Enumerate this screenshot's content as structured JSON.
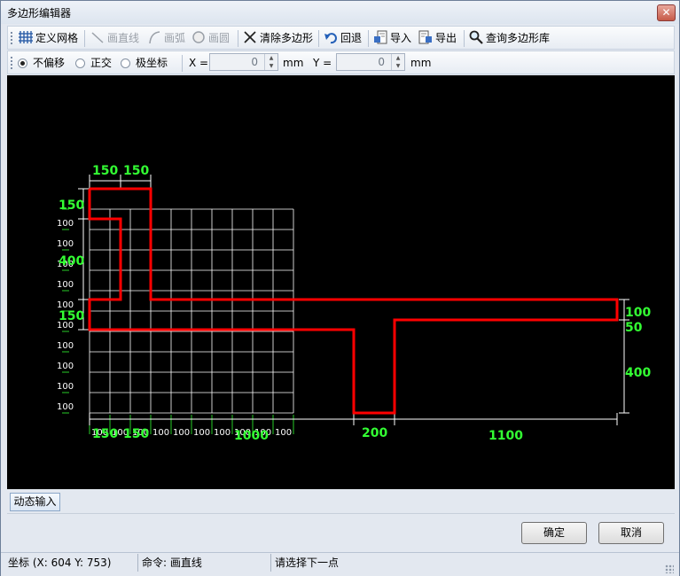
{
  "window": {
    "title": "多边形编辑器",
    "close": "✕"
  },
  "toolbar": {
    "define_grid": "定义网格",
    "draw_line": "画直线",
    "draw_arc": "画弧",
    "draw_circle": "画圆",
    "clear_polygon": "清除多边形",
    "undo": "回退",
    "import": "导入",
    "export": "导出",
    "query_library": "查询多边形库"
  },
  "mode_bar": {
    "no_offset": "不偏移",
    "orthogonal": "正交",
    "polar": "极坐标",
    "selected": "no_offset",
    "x_label": "X =",
    "x_value": "0",
    "x_unit": "mm",
    "y_label": "Y =",
    "y_value": "0",
    "y_unit": "mm"
  },
  "canvas": {
    "colors": {
      "background": "#000000",
      "grid": "#ffffff",
      "polygon": "#ff0000",
      "dimension_text": "#33ff33"
    },
    "grid_row_labels": [
      "100",
      "100",
      "100",
      "100",
      "100",
      "100",
      "100",
      "100",
      "100",
      "100"
    ],
    "grid_col_labels": [
      "100",
      "100",
      "100",
      "100",
      "100",
      "100",
      "100",
      "100",
      "100",
      "100"
    ],
    "overlay_labels": {
      "left_150_a": "150",
      "left_400": "400",
      "left_150_b": "150",
      "row_100_merge": "100",
      "top_150_a": "150",
      "top_150_b": "150",
      "bottom_150_a": "150",
      "bottom_150_b": "150",
      "bottom_1000": "1000",
      "bottom_200": "200",
      "bottom_1100": "1100",
      "right_100": "100",
      "right_50": "50",
      "right_400": "400"
    }
  },
  "dynamic_input": "动态输入",
  "buttons": {
    "ok": "确定",
    "cancel": "取消"
  },
  "status": {
    "coords": "坐标 (X: 604 Y: 753)",
    "command": "命令: 画直线",
    "prompt": "请选择下一点"
  }
}
